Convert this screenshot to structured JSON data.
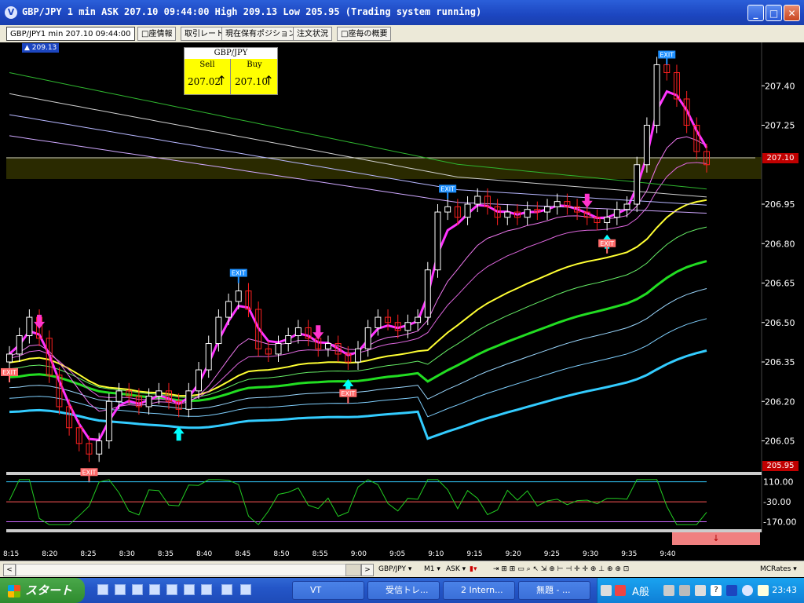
{
  "window": {
    "title": "GBP/JPY 1 min ASK 207.10 09:44:00 High 209.13 Low 205.95 (Trading system running)",
    "title_icon": "vt-logo-icon",
    "buttons": {
      "minimize": "_",
      "maximize": "□",
      "close": "✕"
    }
  },
  "tabs": [
    {
      "label": "GBP/JPY1 min 207.10 09:44:00",
      "active": true
    },
    {
      "label": "□座情報",
      "active": false
    },
    {
      "label": "取引レート",
      "active": false
    },
    {
      "label": "現在保有ポジション",
      "active": false
    },
    {
      "label": "注文状況",
      "active": false
    },
    {
      "label": "□座毎の概要",
      "active": false
    }
  ],
  "chart": {
    "high_badge": "209.13",
    "quote": {
      "symbol": "GBP/JPY",
      "sell_label": "Sell",
      "sell_price": "207.02",
      "buy_label": "Buy",
      "buy_price": "207.10",
      "arrow": "↑"
    },
    "current_price_label": "207.10",
    "low_price_label": "205.95",
    "exit_label": "EXIT",
    "oscillator_marker": "↓",
    "colors": {
      "background": "#000000",
      "candle_up": "#ffffff",
      "candle_down": "#ff2020",
      "fast_ma": "#ff33ff",
      "slow_ma": "#33ccff",
      "yellow_ma": "#ffff33",
      "green_ma": "#22dd22",
      "buy_arrow": "#00ffff",
      "sell_arrow": "#ff33cc",
      "exit_blue": "#1e90ff",
      "exit_red": "#ff6b6b",
      "price_label_bg": "#c00000"
    }
  },
  "chart_data": {
    "type": "candlestick",
    "symbol": "GBP/JPY",
    "timeframe": "1 min",
    "y_ticks": [
      207.4,
      207.25,
      206.95,
      206.8,
      206.65,
      206.5,
      206.35,
      206.2,
      206.05
    ],
    "y_tick_labels": [
      "207.40",
      "207.25",
      "206.95",
      "206.80",
      "206.65",
      "206.50",
      "206.35",
      "206.20",
      "206.05"
    ],
    "ylim": [
      205.95,
      207.55
    ],
    "x_tick_labels": [
      "8:15",
      "8:20",
      "8:25",
      "8:30",
      "8:35",
      "8:40",
      "8:45",
      "8:50",
      "8:55",
      "9:00",
      "9:05",
      "9:10",
      "9:15",
      "9:20",
      "9:25",
      "9:30",
      "9:35",
      "9:40"
    ],
    "close_prices": [
      206.38,
      206.45,
      206.52,
      206.44,
      206.3,
      206.18,
      206.1,
      206.04,
      206.0,
      206.05,
      206.2,
      206.24,
      206.22,
      206.18,
      206.22,
      206.24,
      206.2,
      206.17,
      206.24,
      206.32,
      206.42,
      206.52,
      206.58,
      206.62,
      206.55,
      206.4,
      206.38,
      206.42,
      206.45,
      206.48,
      206.44,
      206.4,
      206.42,
      206.38,
      206.35,
      206.4,
      206.48,
      206.52,
      206.5,
      206.47,
      206.5,
      206.52,
      206.7,
      206.92,
      206.94,
      206.9,
      206.95,
      206.98,
      206.94,
      206.9,
      206.92,
      206.9,
      206.93,
      206.92,
      206.94,
      206.96,
      206.94,
      206.92,
      206.9,
      206.88,
      206.9,
      206.93,
      206.95,
      207.1,
      207.25,
      207.48,
      207.45,
      207.35,
      207.25,
      207.15,
      207.1
    ],
    "oscillator": {
      "levels": [
        110.0,
        -30.0,
        -170.0
      ],
      "level_labels": [
        "110.00",
        "-30.00",
        "-170.00"
      ]
    }
  },
  "scrollbar": {
    "symbol_select": "GBP/JPY",
    "timeframe_select": "M1",
    "price_select": "ASK",
    "rates_select": "MCRates"
  },
  "taskbar": {
    "start_label": "スタート",
    "tasks": [
      {
        "label": "VT",
        "icon": "vt-logo-icon"
      },
      {
        "label": "受信トレ...",
        "icon": "mail-icon"
      },
      {
        "label": "2 Intern...",
        "icon": "ie-icon"
      },
      {
        "label": "無題 - ...",
        "icon": "paint-icon"
      }
    ],
    "ime_label": "A般",
    "clock": "23:43"
  }
}
